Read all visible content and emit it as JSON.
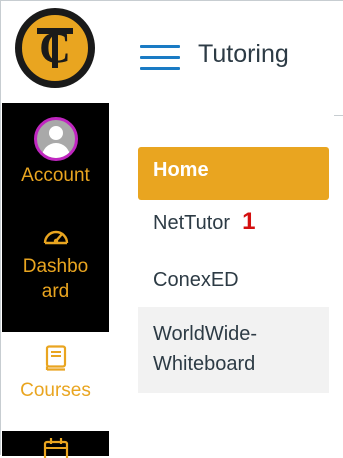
{
  "header": {
    "title": "Tutoring"
  },
  "global_nav": {
    "logo_text": "TC",
    "items": [
      {
        "label": "Account",
        "icon": "avatar-icon"
      },
      {
        "label": "Dashbo ard",
        "label_lines": [
          "Dashbo",
          "ard"
        ],
        "icon": "speedometer-icon"
      },
      {
        "label": "Courses",
        "icon": "book-icon",
        "selected": true
      },
      {
        "label": "",
        "icon": "calendar-icon"
      }
    ]
  },
  "course_nav": {
    "items": [
      {
        "label": "Home",
        "active": true
      },
      {
        "label": "NetTutor",
        "annotation": "1"
      },
      {
        "label": "ConexED"
      },
      {
        "label": "WorldWide-Whiteboard",
        "label_lines": [
          "WorldWide-",
          "Whiteboard"
        ]
      }
    ]
  },
  "colors": {
    "brand_gold": "#e9a520",
    "nav_black": "#000000",
    "link_blue": "#1a7bc4",
    "text_dark": "#2d3b45",
    "annotation_red": "#d40f0f",
    "avatar_border": "#c026c0"
  }
}
